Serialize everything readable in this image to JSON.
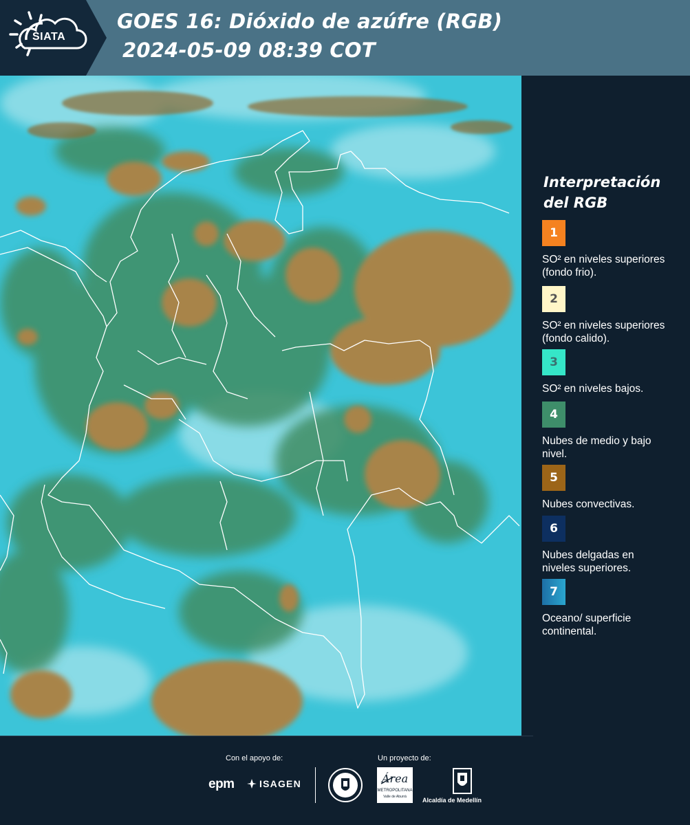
{
  "header": {
    "logo_text": "SIATA",
    "title_line1": "GOES 16: Dióxido de azúfre (RGB)",
    "title_line2": "2024-05-09 08:39 COT"
  },
  "map": {
    "description_colors": {
      "background": "#3cc3d6",
      "clouds": "#a5814a",
      "vegetation": "#3d8a5d",
      "boundaries": "#ffffff"
    }
  },
  "legend": {
    "title": "Interpretación del RGB",
    "items": [
      {
        "number": "1",
        "color": "#f58220",
        "text_color": "#ffffff",
        "label": "SO² en niveles superiores (fondo frio)."
      },
      {
        "number": "2",
        "color": "#fff6c8",
        "text_color": "#555555",
        "label": "SO² en niveles superiores (fondo calido)."
      },
      {
        "number": "3",
        "color": "#35e6c8",
        "text_color": "#3a7070",
        "label": "SO² en niveles bajos."
      },
      {
        "number": "4",
        "color": "#3e8e6a",
        "text_color": "#ffffff",
        "label": "Nubes de medio y bajo nivel."
      },
      {
        "number": "5",
        "color": "#9c6518",
        "text_color": "#ffffff",
        "label": "Nubes convectivas."
      },
      {
        "number": "6",
        "color": "#0d2f60",
        "text_color": "#ffffff",
        "label": "Nubes delgadas en niveles superiores."
      },
      {
        "number": "7",
        "color": "#2aa6cf",
        "text_color": "#ffffff",
        "label": "Oceano/ superficie continental."
      }
    ]
  },
  "footer": {
    "support_label": "Con el apoyo de:",
    "project_label": "Un proyecto de:",
    "sponsor_epm": "epm",
    "sponsor_isagen": "ISAGEN",
    "area_text": "METROPOLITANA",
    "area_subtext": "Valle de Aburrá",
    "alcaldia_text": "Alcaldía de Medellín"
  }
}
